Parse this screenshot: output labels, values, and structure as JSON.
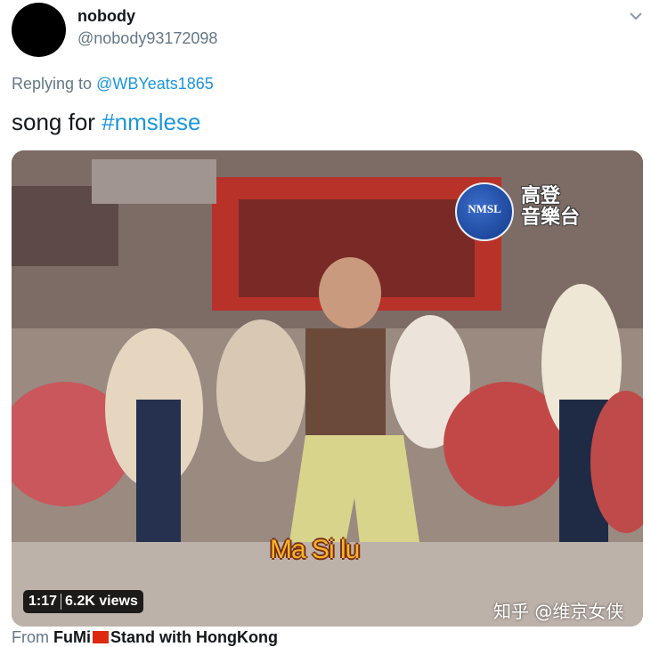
{
  "tweet": {
    "display_name": "nobody",
    "handle": "@nobody93172098",
    "reply_prefix": "Replying to",
    "reply_to": "@WBYeats1865",
    "text_before": "song for",
    "hashtag": "#nmslese",
    "menu_icon": "chevron-down-icon"
  },
  "media": {
    "logo_text": "NMSL",
    "station_name": "高登\n音樂台",
    "subtitle": "Ma Si lu",
    "duration": "1:17",
    "views": "6.2K views",
    "watermark": "知乎 @维京女侠"
  },
  "footer": {
    "from_prefix": "From",
    "app_name": "FuMi",
    "app_suffix": "Stand with HongKong"
  },
  "colors": {
    "link": "#1b95e0",
    "secondary_text": "#657786",
    "primary_text": "#14171a"
  }
}
